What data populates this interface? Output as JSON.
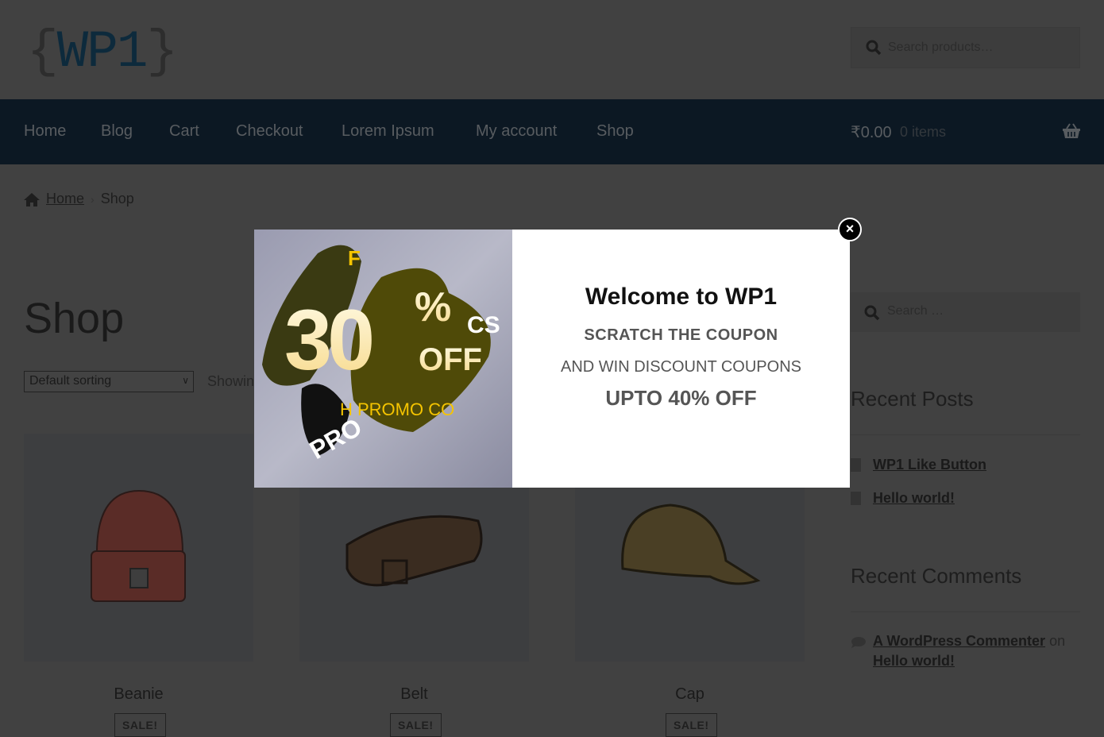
{
  "header": {
    "logo_open": "{",
    "logo_text": "WP1",
    "logo_close": "}",
    "search_placeholder": "Search products…"
  },
  "nav": {
    "items": [
      "Home",
      "Blog",
      "Cart",
      "Checkout",
      "Lorem Ipsum",
      "My account",
      "Shop"
    ],
    "cart_total": "₹0.00",
    "cart_count": "0 items"
  },
  "breadcrumb": {
    "home": "Home",
    "current": "Shop"
  },
  "main": {
    "title": "Shop",
    "sorting": "Default sorting",
    "showing": "Showing",
    "products": [
      {
        "name": "Beanie",
        "badge": "SALE!"
      },
      {
        "name": "Belt",
        "badge": "SALE!"
      },
      {
        "name": "Cap",
        "badge": "SALE!"
      }
    ]
  },
  "sidebar": {
    "search_placeholder": "Search …",
    "recent_posts_title": "Recent Posts",
    "recent_posts": [
      "WP1 Like Button",
      "Hello world!"
    ],
    "recent_comments_title": "Recent Comments",
    "comment": {
      "author": "A WordPress Commenter",
      "on": "on",
      "post": "Hello world!"
    }
  },
  "modal": {
    "title": "Welcome to WP1",
    "line1": "SCRATCH THE COUPON",
    "line2": "AND WIN DISCOUNT COUPONS",
    "line3": "UPTO 40% OFF",
    "close": "×",
    "promo_image": {
      "top": "F",
      "number": "30",
      "percent": "%",
      "off": "OFF",
      "promo_code": "H PROMO CO",
      "promo": "PRO",
      "side": "CS"
    }
  },
  "colors": {
    "nav": "#0c1823",
    "overlay": "#414141",
    "accent": "#f5c400"
  }
}
